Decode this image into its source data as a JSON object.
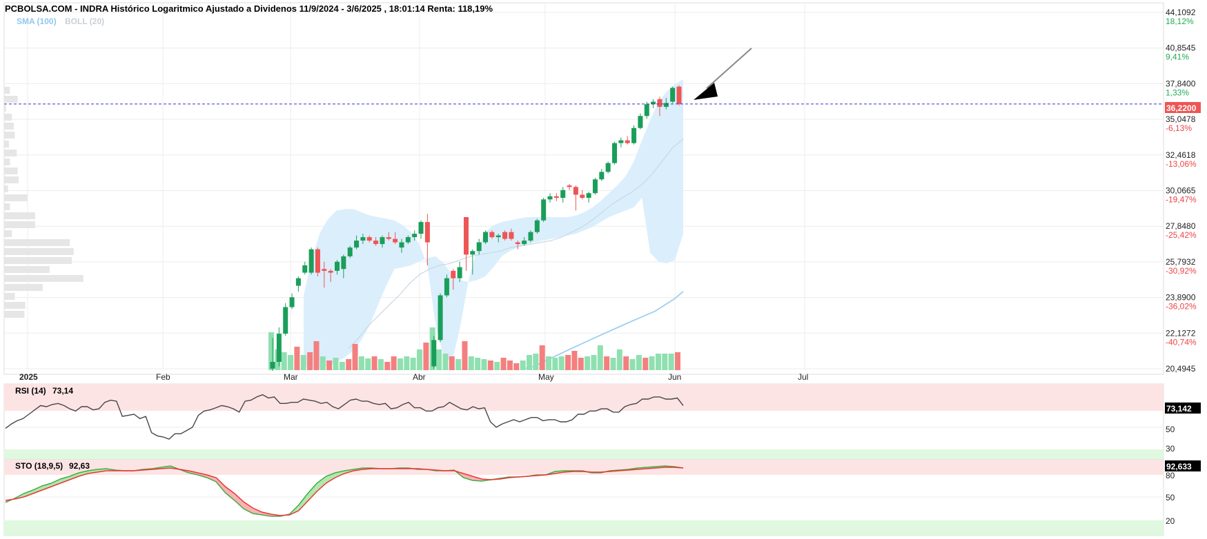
{
  "header": {
    "title": "PCBOLSA.COM - INDRA Histórico Logaritmico Ajustado a Dividenos 11/9/2024 - 3/6/2025 , 18:01:14 Renta: 118,19%",
    "legend_sma": "SMA (100)",
    "legend_boll": "BOLL (20)"
  },
  "colors": {
    "up": "#1a9e5a",
    "down": "#ee5555",
    "vol_up": "#8fe0b0",
    "vol_down": "#f47f7f",
    "boll_fill": "#dbeefc",
    "sma": "#9bd0ef",
    "boll_mid": "#c8d8e4",
    "last_price_line": "#3333cc",
    "rsi_line": "#444444",
    "sto_k": "#44aa44",
    "sto_d": "#ee3333",
    "overbought_band": "#fde4e4",
    "oversold_band": "#dff8df",
    "grid": "#ececec",
    "volume_profile": "#e6e6e6"
  },
  "price_panel": {
    "y_ticks": [
      {
        "value": "44,1092",
        "pct": "18,12%",
        "dir": "up"
      },
      {
        "value": "40,8545",
        "pct": "9,41%",
        "dir": "up"
      },
      {
        "value": "37,8400",
        "pct": "1,33%",
        "dir": "up"
      },
      {
        "value": "35,0478",
        "pct": "-6,13%",
        "dir": "down"
      },
      {
        "value": "32,4618",
        "pct": "-13,06%",
        "dir": "down"
      },
      {
        "value": "30,0665",
        "pct": "-19,47%",
        "dir": "down"
      },
      {
        "value": "27,8480",
        "pct": "-25,42%",
        "dir": "down"
      },
      {
        "value": "25,7932",
        "pct": "-30,92%",
        "dir": "down"
      },
      {
        "value": "23,8900",
        "pct": "-36,02%",
        "dir": "down"
      },
      {
        "value": "22,1272",
        "pct": "-40,74%",
        "dir": "down"
      },
      {
        "value": "20,4945",
        "pct": "",
        "dir": "none"
      }
    ],
    "last_price_label": "36,2200",
    "x_labels": [
      "2025",
      "Feb",
      "Mar",
      "Abr",
      "May",
      "Jun",
      "Jul"
    ]
  },
  "rsi_panel": {
    "label": "RSI (14)",
    "value": "73,14",
    "last_tag": "73,142",
    "level_50": "50",
    "level_30": "30"
  },
  "sto_panel": {
    "label": "STO (18,9,5)",
    "value": "92,63",
    "last_tag": "92,633",
    "level_80": "80",
    "level_50": "50",
    "level_20": "20"
  },
  "chart_data": {
    "type": "candlestick",
    "title": "PCBOLSA.COM - INDRA Histórico Logaritmico Ajustado a Dividenos 11/9/2024 - 3/6/2025 , 18:01:14 Renta: 118,19%",
    "scale": "log",
    "ylim": [
      20.4945,
      44.1092
    ],
    "last_price": 36.22,
    "x_ticks": [
      "2025",
      "Feb",
      "Mar",
      "Abr",
      "May",
      "Jun",
      "Jul"
    ],
    "candles": [
      {
        "x": 0,
        "o": 20.5,
        "h": 21.9,
        "l": 20.4,
        "c": 20.8
      },
      {
        "x": 1,
        "o": 20.8,
        "h": 22.4,
        "l": 20.6,
        "c": 22.1
      },
      {
        "x": 2,
        "o": 22.1,
        "h": 23.6,
        "l": 22.0,
        "c": 23.4
      },
      {
        "x": 3,
        "o": 23.4,
        "h": 24.1,
        "l": 23.3,
        "c": 23.9
      },
      {
        "x": 4,
        "o": 24.5,
        "h": 25.0,
        "l": 24.2,
        "c": 24.9
      },
      {
        "x": 5,
        "o": 25.2,
        "h": 25.8,
        "l": 25.1,
        "c": 25.6
      },
      {
        "x": 6,
        "o": 25.2,
        "h": 26.6,
        "l": 25.1,
        "c": 26.5
      },
      {
        "x": 7,
        "o": 26.5,
        "h": 26.6,
        "l": 25.0,
        "c": 25.2
      },
      {
        "x": 8,
        "o": 25.4,
        "h": 25.8,
        "l": 24.4,
        "c": 25.3
      },
      {
        "x": 9,
        "o": 25.3,
        "h": 25.4,
        "l": 24.7,
        "c": 25.2
      },
      {
        "x": 10,
        "o": 25.3,
        "h": 25.9,
        "l": 25.1,
        "c": 25.8
      },
      {
        "x": 11,
        "o": 25.4,
        "h": 26.2,
        "l": 24.9,
        "c": 26.1
      },
      {
        "x": 12,
        "o": 26.1,
        "h": 26.7,
        "l": 26.0,
        "c": 26.6
      },
      {
        "x": 13,
        "o": 26.6,
        "h": 27.3,
        "l": 26.5,
        "c": 27.0
      },
      {
        "x": 14,
        "o": 27.0,
        "h": 27.4,
        "l": 26.8,
        "c": 27.2
      },
      {
        "x": 15,
        "o": 27.2,
        "h": 27.3,
        "l": 26.9,
        "c": 27.0
      },
      {
        "x": 16,
        "o": 27.0,
        "h": 27.2,
        "l": 26.7,
        "c": 26.8
      },
      {
        "x": 17,
        "o": 26.8,
        "h": 27.3,
        "l": 26.6,
        "c": 27.2
      },
      {
        "x": 18,
        "o": 27.2,
        "h": 27.5,
        "l": 27.0,
        "c": 27.1
      },
      {
        "x": 19,
        "o": 27.1,
        "h": 27.5,
        "l": 26.8,
        "c": 26.9
      },
      {
        "x": 20,
        "o": 26.6,
        "h": 27.1,
        "l": 26.3,
        "c": 26.9
      },
      {
        "x": 21,
        "o": 26.9,
        "h": 27.3,
        "l": 26.8,
        "c": 27.2
      },
      {
        "x": 22,
        "o": 27.2,
        "h": 27.6,
        "l": 27.0,
        "c": 27.4
      },
      {
        "x": 23,
        "o": 27.4,
        "h": 28.2,
        "l": 27.1,
        "c": 28.1
      },
      {
        "x": 24,
        "o": 28.1,
        "h": 28.6,
        "l": 25.6,
        "c": 26.9
      },
      {
        "x": 25,
        "o": 20.6,
        "h": 22.0,
        "l": 20.5,
        "c": 21.8
      },
      {
        "x": 26,
        "o": 21.8,
        "h": 24.1,
        "l": 21.7,
        "c": 24.0
      },
      {
        "x": 27,
        "o": 24.0,
        "h": 25.1,
        "l": 23.9,
        "c": 24.9
      },
      {
        "x": 28,
        "o": 25.3,
        "h": 25.4,
        "l": 24.3,
        "c": 24.9
      },
      {
        "x": 29,
        "o": 24.9,
        "h": 25.8,
        "l": 24.7,
        "c": 25.5
      },
      {
        "x": 30,
        "o": 28.4,
        "h": 28.4,
        "l": 25.3,
        "c": 26.2
      },
      {
        "x": 31,
        "o": 26.2,
        "h": 26.5,
        "l": 25.1,
        "c": 26.4
      },
      {
        "x": 32,
        "o": 26.4,
        "h": 27.1,
        "l": 26.2,
        "c": 26.9
      },
      {
        "x": 33,
        "o": 26.9,
        "h": 27.6,
        "l": 26.8,
        "c": 27.5
      },
      {
        "x": 34,
        "o": 27.5,
        "h": 27.6,
        "l": 27.1,
        "c": 27.2
      },
      {
        "x": 35,
        "o": 27.2,
        "h": 27.4,
        "l": 26.9,
        "c": 27.3
      },
      {
        "x": 36,
        "o": 27.5,
        "h": 27.6,
        "l": 27.0,
        "c": 27.1
      },
      {
        "x": 37,
        "o": 27.5,
        "h": 27.7,
        "l": 27.0,
        "c": 27.1
      },
      {
        "x": 38,
        "o": 26.9,
        "h": 27.0,
        "l": 26.5,
        "c": 26.8
      },
      {
        "x": 39,
        "o": 26.8,
        "h": 27.2,
        "l": 26.7,
        "c": 27.0
      },
      {
        "x": 40,
        "o": 27.0,
        "h": 27.6,
        "l": 26.9,
        "c": 27.5
      },
      {
        "x": 41,
        "o": 27.5,
        "h": 28.3,
        "l": 27.4,
        "c": 28.2
      },
      {
        "x": 42,
        "o": 28.2,
        "h": 29.6,
        "l": 28.1,
        "c": 29.5
      },
      {
        "x": 43,
        "o": 29.5,
        "h": 29.9,
        "l": 29.3,
        "c": 29.7
      },
      {
        "x": 44,
        "o": 29.7,
        "h": 29.9,
        "l": 29.4,
        "c": 29.6
      },
      {
        "x": 45,
        "o": 29.6,
        "h": 30.3,
        "l": 29.3,
        "c": 30.1
      },
      {
        "x": 46,
        "o": 30.4,
        "h": 30.5,
        "l": 30.1,
        "c": 30.3
      },
      {
        "x": 47,
        "o": 30.3,
        "h": 30.4,
        "l": 28.8,
        "c": 29.8
      },
      {
        "x": 48,
        "o": 29.8,
        "h": 30.1,
        "l": 29.5,
        "c": 29.6
      },
      {
        "x": 49,
        "o": 29.6,
        "h": 30.0,
        "l": 29.3,
        "c": 29.9
      },
      {
        "x": 50,
        "o": 29.9,
        "h": 30.9,
        "l": 29.8,
        "c": 30.8
      },
      {
        "x": 51,
        "o": 30.8,
        "h": 31.5,
        "l": 30.7,
        "c": 31.3
      },
      {
        "x": 52,
        "o": 31.3,
        "h": 32.0,
        "l": 31.2,
        "c": 31.9
      },
      {
        "x": 53,
        "o": 31.9,
        "h": 33.4,
        "l": 31.8,
        "c": 33.3
      },
      {
        "x": 54,
        "o": 33.3,
        "h": 33.7,
        "l": 33.0,
        "c": 33.5
      },
      {
        "x": 55,
        "o": 33.5,
        "h": 33.8,
        "l": 33.2,
        "c": 33.3
      },
      {
        "x": 56,
        "o": 33.3,
        "h": 34.6,
        "l": 33.2,
        "c": 34.4
      },
      {
        "x": 57,
        "o": 34.4,
        "h": 35.5,
        "l": 34.3,
        "c": 35.3
      },
      {
        "x": 58,
        "o": 35.3,
        "h": 36.4,
        "l": 35.1,
        "c": 36.2
      },
      {
        "x": 59,
        "o": 36.2,
        "h": 36.6,
        "l": 35.9,
        "c": 36.4
      },
      {
        "x": 60,
        "o": 36.6,
        "h": 36.8,
        "l": 35.3,
        "c": 36.0
      },
      {
        "x": 61,
        "o": 36.0,
        "h": 36.7,
        "l": 35.8,
        "c": 36.3
      },
      {
        "x": 62,
        "o": 36.4,
        "h": 37.6,
        "l": 36.3,
        "c": 37.5
      },
      {
        "x": 63,
        "o": 37.6,
        "h": 37.7,
        "l": 36.1,
        "c": 36.22
      }
    ],
    "volume": [
      {
        "x": 0,
        "v": 55,
        "up": true
      },
      {
        "x": 1,
        "v": 30,
        "up": true
      },
      {
        "x": 2,
        "v": 26,
        "up": true
      },
      {
        "x": 3,
        "v": 22,
        "up": true
      },
      {
        "x": 4,
        "v": 34,
        "up": false
      },
      {
        "x": 5,
        "v": 22,
        "up": true
      },
      {
        "x": 6,
        "v": 26,
        "up": false
      },
      {
        "x": 7,
        "v": 42,
        "up": false
      },
      {
        "x": 8,
        "v": 20,
        "up": true
      },
      {
        "x": 9,
        "v": 14,
        "up": false
      },
      {
        "x": 10,
        "v": 18,
        "up": true
      },
      {
        "x": 11,
        "v": 12,
        "up": true
      },
      {
        "x": 12,
        "v": 16,
        "up": false
      },
      {
        "x": 13,
        "v": 38,
        "up": false
      },
      {
        "x": 14,
        "v": 20,
        "up": true
      },
      {
        "x": 15,
        "v": 17,
        "up": true
      },
      {
        "x": 16,
        "v": 20,
        "up": false
      },
      {
        "x": 17,
        "v": 16,
        "up": true
      },
      {
        "x": 18,
        "v": 12,
        "up": false
      },
      {
        "x": 19,
        "v": 20,
        "up": false
      },
      {
        "x": 20,
        "v": 17,
        "up": true
      },
      {
        "x": 21,
        "v": 20,
        "up": true
      },
      {
        "x": 22,
        "v": 18,
        "up": true
      },
      {
        "x": 23,
        "v": 30,
        "up": true
      },
      {
        "x": 24,
        "v": 40,
        "up": false
      },
      {
        "x": 25,
        "v": 62,
        "up": true
      },
      {
        "x": 26,
        "v": 30,
        "up": true
      },
      {
        "x": 27,
        "v": 24,
        "up": true
      },
      {
        "x": 28,
        "v": 20,
        "up": false
      },
      {
        "x": 29,
        "v": 16,
        "up": true
      },
      {
        "x": 30,
        "v": 42,
        "up": false
      },
      {
        "x": 31,
        "v": 20,
        "up": true
      },
      {
        "x": 32,
        "v": 18,
        "up": true
      },
      {
        "x": 33,
        "v": 16,
        "up": true
      },
      {
        "x": 34,
        "v": 14,
        "up": false
      },
      {
        "x": 35,
        "v": 12,
        "up": true
      },
      {
        "x": 36,
        "v": 18,
        "up": false
      },
      {
        "x": 37,
        "v": 14,
        "up": false
      },
      {
        "x": 38,
        "v": 10,
        "up": false
      },
      {
        "x": 39,
        "v": 14,
        "up": true
      },
      {
        "x": 40,
        "v": 22,
        "up": true
      },
      {
        "x": 41,
        "v": 24,
        "up": true
      },
      {
        "x": 42,
        "v": 36,
        "up": false
      },
      {
        "x": 43,
        "v": 20,
        "up": true
      },
      {
        "x": 44,
        "v": 18,
        "up": true
      },
      {
        "x": 45,
        "v": 20,
        "up": true
      },
      {
        "x": 46,
        "v": 22,
        "up": false
      },
      {
        "x": 47,
        "v": 28,
        "up": false
      },
      {
        "x": 48,
        "v": 18,
        "up": false
      },
      {
        "x": 49,
        "v": 20,
        "up": true
      },
      {
        "x": 50,
        "v": 22,
        "up": true
      },
      {
        "x": 51,
        "v": 36,
        "up": true
      },
      {
        "x": 52,
        "v": 20,
        "up": false
      },
      {
        "x": 53,
        "v": 18,
        "up": true
      },
      {
        "x": 54,
        "v": 30,
        "up": true
      },
      {
        "x": 55,
        "v": 20,
        "up": false
      },
      {
        "x": 56,
        "v": 16,
        "up": true
      },
      {
        "x": 57,
        "v": 22,
        "up": true
      },
      {
        "x": 58,
        "v": 18,
        "up": false
      },
      {
        "x": 59,
        "v": 20,
        "up": true
      },
      {
        "x": 60,
        "v": 24,
        "up": true
      },
      {
        "x": 61,
        "v": 24,
        "up": true
      },
      {
        "x": 62,
        "v": 24,
        "up": true
      },
      {
        "x": 63,
        "v": 26,
        "up": false
      }
    ],
    "boll_upper": [
      24.0,
      26.0,
      27.5,
      28.3,
      28.8,
      28.9,
      28.9,
      28.7,
      28.5,
      28.4,
      28.3,
      28.2,
      27.9,
      27.5,
      26.8,
      25.6,
      22.5,
      21.0,
      20.8,
      22.5,
      24.8,
      26.5,
      27.5,
      27.9,
      28.1,
      28.2,
      28.3,
      28.4,
      28.4,
      28.4,
      28.4,
      28.4,
      28.4,
      28.5,
      28.7,
      29.0,
      29.4,
      29.9,
      30.4,
      31.0,
      32.0,
      33.5,
      35.0,
      36.4,
      37.2,
      37.8,
      38.2
    ],
    "boll_lower": [
      20.6,
      20.5,
      20.5,
      20.6,
      20.8,
      21.0,
      21.3,
      21.8,
      22.5,
      23.5,
      24.5,
      25.4,
      25.5,
      25.6,
      25.8,
      26.0,
      26.1,
      25.7,
      25.1,
      24.8,
      24.7,
      24.8,
      25.0,
      25.5,
      26.1,
      26.4,
      26.6,
      26.8,
      26.9,
      27.0,
      27.1,
      27.2,
      27.3,
      27.4,
      27.6,
      27.8,
      28.1,
      28.4,
      28.6,
      28.8,
      29.0,
      29.6,
      26.3,
      25.8,
      25.7,
      25.9,
      27.4
    ],
    "boll_middle": [
      21.4,
      21.9,
      22.5,
      23.0,
      23.5,
      24.0,
      24.6,
      25.1,
      25.4,
      25.6,
      25.7,
      25.9,
      26.1,
      26.2,
      26.3,
      26.4,
      26.6,
      26.7,
      26.8,
      26.9,
      27.0,
      27.2,
      27.5,
      27.8,
      28.2,
      28.7,
      29.2,
      29.6,
      30.0,
      30.5,
      31.2,
      32.1,
      33.0,
      33.6
    ],
    "sma_100": [
      20.5,
      20.6,
      20.8,
      21.0,
      21.2,
      21.4,
      21.6,
      21.8,
      22.0,
      22.2,
      22.4,
      22.6,
      22.8,
      23.0,
      23.2,
      23.5,
      23.8,
      24.2
    ],
    "rsi": {
      "name": "RSI (14)",
      "last": 73.14,
      "levels": [
        30,
        50,
        70
      ],
      "values": [
        49,
        53,
        56,
        58,
        62,
        66,
        70,
        69,
        71,
        72,
        70,
        67,
        65,
        69,
        69,
        66,
        67,
        73,
        75,
        74,
        60,
        61,
        62,
        58,
        60,
        45,
        42,
        41,
        39,
        44,
        44,
        47,
        50,
        61,
        65,
        66,
        68,
        70,
        69,
        67,
        64,
        74,
        75,
        78,
        80,
        77,
        78,
        72,
        72,
        73,
        73,
        76,
        75,
        74,
        72,
        73,
        69,
        67,
        71,
        75,
        76,
        74,
        74,
        72,
        71,
        72,
        67,
        68,
        71,
        73,
        68,
        68,
        65,
        65,
        68,
        69,
        73,
        70,
        67,
        66,
        69,
        67,
        68,
        55,
        50,
        53,
        55,
        57,
        55,
        57,
        59,
        59,
        56,
        57,
        57,
        55,
        55,
        57,
        62,
        62,
        65,
        65,
        67,
        67,
        64,
        64,
        69,
        71,
        72,
        76,
        76,
        78,
        78,
        76,
        76,
        77,
        70
      ]
    },
    "stochastic": {
      "name": "STO (18,9,5)",
      "last": 92.63,
      "levels": [
        20,
        50,
        80
      ],
      "k": [
        42,
        48,
        55,
        60,
        66,
        70,
        76,
        80,
        85,
        88,
        90,
        91,
        89,
        88,
        88,
        90,
        91,
        93,
        95,
        90,
        85,
        82,
        78,
        72,
        56,
        45,
        33,
        26,
        24,
        22,
        22,
        25,
        38,
        55,
        70,
        80,
        85,
        88,
        90,
        92,
        92,
        91,
        91,
        92,
        92,
        90,
        90,
        88,
        88,
        89,
        78,
        74,
        73,
        75,
        77,
        79,
        79,
        80,
        82,
        82,
        87,
        88,
        88,
        88,
        85,
        85,
        88,
        89,
        90,
        92,
        93,
        94,
        95,
        94,
        92
      ],
      "d": [
        45,
        47,
        50,
        55,
        60,
        65,
        70,
        75,
        80,
        84,
        86,
        88,
        88,
        88,
        88,
        89,
        90,
        91,
        92,
        90,
        88,
        85,
        82,
        78,
        65,
        55,
        43,
        34,
        28,
        25,
        23,
        24,
        30,
        44,
        58,
        70,
        78,
        84,
        88,
        90,
        91,
        91,
        91,
        91,
        91,
        91,
        90,
        89,
        88,
        88,
        84,
        80,
        76,
        75,
        76,
        78,
        79,
        80,
        81,
        82,
        84,
        86,
        87,
        87,
        86,
        86,
        87,
        88,
        89,
        90,
        91,
        92,
        93,
        93,
        92
      ]
    },
    "volume_profile": [
      6,
      14,
      2,
      8,
      10,
      11,
      5,
      13,
      6,
      14,
      15,
      4,
      24,
      6,
      32,
      32,
      8,
      68,
      72,
      70,
      47,
      82,
      40,
      11,
      22,
      21
    ]
  }
}
